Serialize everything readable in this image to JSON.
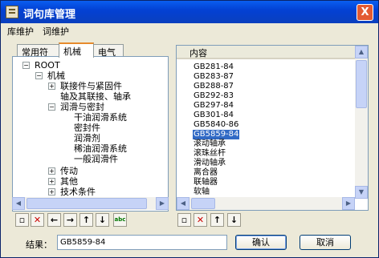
{
  "window": {
    "title": "词句库管理",
    "close_label": "X"
  },
  "menu": [
    "库维护",
    "词维护"
  ],
  "tabs": [
    {
      "label": "常用符号",
      "active": false
    },
    {
      "label": "机械",
      "active": true
    },
    {
      "label": "电气",
      "active": false
    }
  ],
  "tree": [
    {
      "label": "ROOT",
      "expander": "−"
    },
    {
      "label": "机械",
      "expander": "−"
    },
    {
      "label": "联接件与紧固件",
      "expander": "+"
    },
    {
      "label": "轴及其联接、轴承",
      "expander": ""
    },
    {
      "label": "润滑与密封",
      "expander": "−"
    },
    {
      "label": "干油润滑系统",
      "expander": ""
    },
    {
      "label": "密封件",
      "expander": ""
    },
    {
      "label": "润滑剂",
      "expander": ""
    },
    {
      "label": "稀油润滑系统",
      "expander": ""
    },
    {
      "label": "一般润滑件",
      "expander": ""
    },
    {
      "label": "传动",
      "expander": "+"
    },
    {
      "label": "其他",
      "expander": "+"
    },
    {
      "label": "技术条件",
      "expander": "+"
    },
    {
      "label": "材料",
      "expander": "+"
    }
  ],
  "list": {
    "header": "内容",
    "items": [
      "GB281-84",
      "GB283-87",
      "GB288-87",
      "GB292-83",
      "GB297-84",
      "GB301-84",
      "GB5840-86",
      "GB5859-84",
      "滚动轴承",
      "滚珠丝杆",
      "滑动轴承",
      "离合器",
      "联轴器",
      "软轴"
    ],
    "selected_index": 7
  },
  "left_toolbar_icons": [
    "new-doc-icon",
    "delete-icon",
    "arrow-left-icon",
    "arrow-right-icon",
    "arrow-up-icon",
    "arrow-down-icon",
    "abc-icon"
  ],
  "right_toolbar_icons": [
    "new-doc-icon",
    "delete-icon",
    "arrow-up-icon",
    "arrow-down-icon"
  ],
  "result": {
    "label": "结果：",
    "value": "GB5859-84"
  },
  "buttons": {
    "ok": "确认",
    "cancel": "取消"
  },
  "colors": {
    "titlebar": "#0a5ef0",
    "selection": "#316ac5",
    "dialog_bg": "#ece9d8",
    "active_tab_accent": "#e68b2c"
  }
}
